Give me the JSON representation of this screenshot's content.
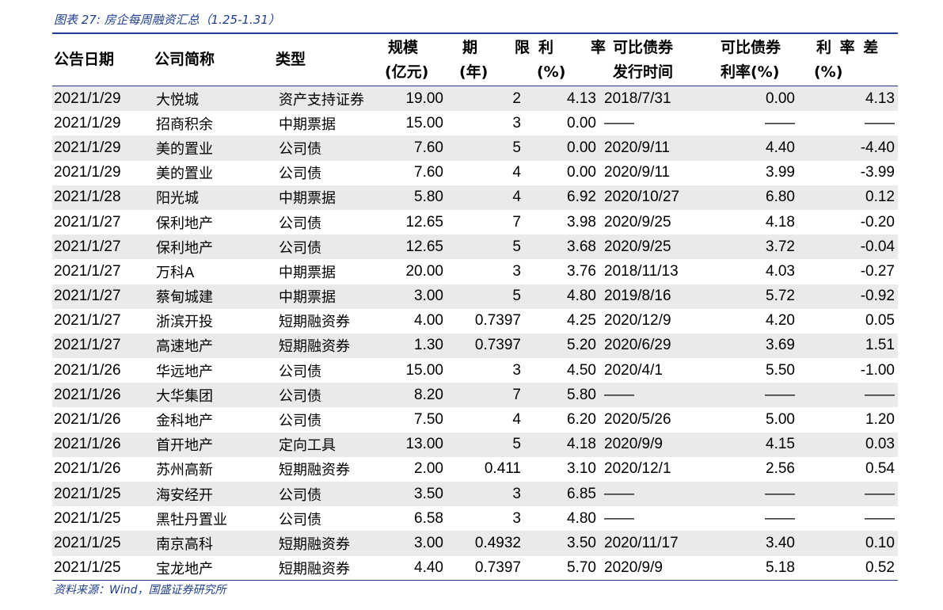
{
  "caption": "图表 27:  房企每周融资汇总（1.25-1.31）",
  "headers": {
    "date": "公告日期",
    "company": "公司简称",
    "type": "类型",
    "scale_1": "规模",
    "scale_2": "(亿元)",
    "term_1": "期　限",
    "term_2": "(年)",
    "rate_1": "利　率",
    "rate_2": "(%)",
    "comp_time_1": "可比债券",
    "comp_time_2": "发行时间",
    "comp_rate_1": "可比债券",
    "comp_rate_2": "利率(%)",
    "spread_1": "利 率 差",
    "spread_2": "(%)"
  },
  "rows": [
    [
      "2021/1/29",
      "大悦城",
      "资产支持证券",
      "19.00",
      "2",
      "4.13",
      "2018/7/31",
      "0.00",
      "4.13"
    ],
    [
      "2021/1/29",
      "招商积余",
      "中期票据",
      "15.00",
      "3",
      "0.00",
      "——",
      "——",
      "——"
    ],
    [
      "2021/1/29",
      "美的置业",
      "公司债",
      "7.60",
      "5",
      "0.00",
      "2020/9/11",
      "4.40",
      "-4.40"
    ],
    [
      "2021/1/29",
      "美的置业",
      "公司债",
      "7.60",
      "4",
      "0.00",
      "2020/9/11",
      "3.99",
      "-3.99"
    ],
    [
      "2021/1/28",
      "阳光城",
      "中期票据",
      "5.80",
      "4",
      "6.92",
      "2020/10/27",
      "6.80",
      "0.12"
    ],
    [
      "2021/1/27",
      "保利地产",
      "公司债",
      "12.65",
      "7",
      "3.98",
      "2020/9/25",
      "4.18",
      "-0.20"
    ],
    [
      "2021/1/27",
      "保利地产",
      "公司债",
      "12.65",
      "5",
      "3.68",
      "2020/9/25",
      "3.72",
      "-0.04"
    ],
    [
      "2021/1/27",
      "万科A",
      "中期票据",
      "20.00",
      "3",
      "3.76",
      "2018/11/13",
      "4.03",
      "-0.27"
    ],
    [
      "2021/1/27",
      "蔡甸城建",
      "中期票据",
      "3.00",
      "5",
      "4.80",
      "2019/8/16",
      "5.72",
      "-0.92"
    ],
    [
      "2021/1/27",
      "浙滨开投",
      "短期融资券",
      "4.00",
      "0.7397",
      "4.25",
      "2020/12/9",
      "4.20",
      "0.05"
    ],
    [
      "2021/1/27",
      "高速地产",
      "短期融资券",
      "1.30",
      "0.7397",
      "5.20",
      "2020/6/29",
      "3.69",
      "1.51"
    ],
    [
      "2021/1/26",
      "华远地产",
      "公司债",
      "15.00",
      "3",
      "4.50",
      "2020/4/1",
      "5.50",
      "-1.00"
    ],
    [
      "2021/1/26",
      "大华集团",
      "公司债",
      "8.20",
      "7",
      "5.80",
      "——",
      "——",
      "——"
    ],
    [
      "2021/1/26",
      "金科地产",
      "公司债",
      "7.50",
      "4",
      "6.20",
      "2020/5/26",
      "5.00",
      "1.20"
    ],
    [
      "2021/1/26",
      "首开地产",
      "定向工具",
      "13.00",
      "5",
      "4.18",
      "2020/9/9",
      "4.15",
      "0.03"
    ],
    [
      "2021/1/26",
      "苏州高新",
      "短期融资券",
      "2.00",
      "0.411",
      "3.10",
      "2020/12/1",
      "2.56",
      "0.54"
    ],
    [
      "2021/1/25",
      "海安经开",
      "公司债",
      "3.50",
      "3",
      "6.85",
      "——",
      "——",
      "——"
    ],
    [
      "2021/1/25",
      "黑牡丹置业",
      "公司债",
      "6.58",
      "3",
      "4.80",
      "——",
      "——",
      "——"
    ],
    [
      "2021/1/25",
      "南京高科",
      "短期融资券",
      "3.00",
      "0.4932",
      "3.50",
      "2020/11/17",
      "3.40",
      "0.10"
    ],
    [
      "2021/1/25",
      "宝龙地产",
      "短期融资券",
      "4.40",
      "0.7397",
      "5.70",
      "2020/9/9",
      "5.18",
      "0.52"
    ]
  ],
  "source": "资料来源：Wind，国盛证券研究所",
  "colors": {
    "accent": "#1f3f8f",
    "stripe": "#eaeaea"
  }
}
